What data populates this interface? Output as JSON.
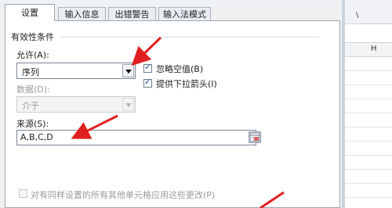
{
  "tabs": [
    {
      "label": "设置",
      "active": true
    },
    {
      "label": "输入信息",
      "active": false
    },
    {
      "label": "出错警告",
      "active": false
    },
    {
      "label": "输入法模式",
      "active": false
    }
  ],
  "validation": {
    "section_title": "有效性条件",
    "allow_label": "允许(A):",
    "allow_value": "序列",
    "data_label": "数据(D):",
    "data_value": "介于",
    "ignore_blank_label": "忽略空值(B)",
    "ignore_blank_checked": true,
    "dropdown_label": "提供下拉箭头(I)",
    "dropdown_checked": true,
    "source_label": "来源(S):",
    "source_value": "A,B,C,D"
  },
  "apply_all": {
    "label": "对有同样设置的所有其他单元格应用这些更改(P)",
    "checked": false,
    "enabled": false
  },
  "sheet": {
    "toolbar_text": "\\",
    "column_header": "H"
  },
  "colors": {
    "arrow": "#e02020",
    "accent": "#1a4fa3"
  }
}
